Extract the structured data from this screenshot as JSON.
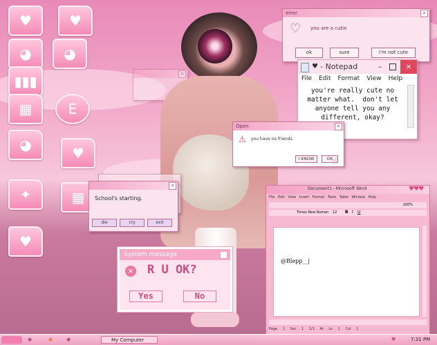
{
  "cutie_dialog": {
    "title": "error",
    "message": "you are a cutie",
    "buttons": [
      "ok",
      "sure",
      "i'm not cute"
    ]
  },
  "notepad": {
    "title": "- Notepad",
    "menu": [
      "File",
      "Edit",
      "Format",
      "View",
      "Help"
    ],
    "text": "you're really cute no\nmatter what.  don't let\nanyone tell you any\ndifferent, okay?"
  },
  "open_dialog": {
    "title": "Open",
    "message": "you have no friends.",
    "buttons": [
      "I KNOW",
      "OK"
    ]
  },
  "school_dialog": {
    "message": "School's starting.",
    "buttons": [
      "die",
      "cry",
      "exit"
    ]
  },
  "word": {
    "title": "Document1 - Microsoft Word",
    "menu": [
      "File",
      "Edit",
      "View",
      "Insert",
      "Format",
      "Tools",
      "Table",
      "Window",
      "Help"
    ],
    "font_name": "Times New Roman",
    "font_size": "12",
    "zoom": "100%",
    "doc_text": "@Blepp__|",
    "status": [
      "Page 1",
      "Sec 1",
      "1/1",
      "At",
      "Ln 1",
      "Col 1"
    ]
  },
  "system_message": {
    "title": "System message",
    "message": "R U OK?",
    "buttons": [
      "Yes",
      "No"
    ]
  },
  "taskbar": {
    "window_item": "My Computer",
    "clock": "7:31 PM"
  },
  "colors": {
    "accent": "#f7a9c8",
    "text_pink": "#d04a82",
    "close_red": "#e0475d"
  }
}
